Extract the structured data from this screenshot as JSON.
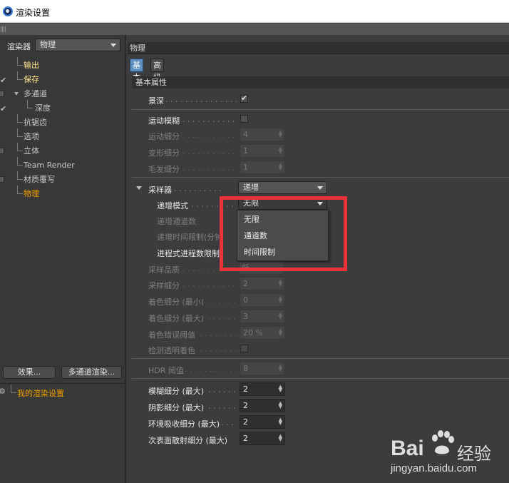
{
  "window": {
    "title": "渲染设置"
  },
  "left": {
    "renderer_label": "渲染器",
    "renderer_value": "物理",
    "tree": [
      {
        "label": "输出",
        "check": "none",
        "style": "hl"
      },
      {
        "label": "保存",
        "check": "tick",
        "style": "hl"
      },
      {
        "label": "多通道",
        "check": "box",
        "style": "normal",
        "expand": true
      },
      {
        "label": "深度",
        "check": "tick",
        "style": "normal",
        "sub": true
      },
      {
        "label": "抗锯齿",
        "check": "none",
        "style": "normal"
      },
      {
        "label": "选项",
        "check": "none",
        "style": "normal"
      },
      {
        "label": "立体",
        "check": "box",
        "style": "normal"
      },
      {
        "label": "Team Render",
        "check": "none",
        "style": "normal"
      },
      {
        "label": "材质覆写",
        "check": "box",
        "style": "normal"
      },
      {
        "label": "物理",
        "check": "none",
        "style": "or"
      }
    ],
    "effects_button": "效果...",
    "multipass_button": "多通道渲染...",
    "my_settings": "我的渲染设置"
  },
  "right": {
    "header": "物理",
    "tabs": [
      "基本",
      "高级"
    ],
    "section": "基本属性",
    "depth_of_field": {
      "label": "景深",
      "dots": " . . . . . . . . . . . . . . . . ",
      "checked": true
    },
    "motion_blur": {
      "label": "运动模糊",
      "dots": " . . . . . . . . . . . . ",
      "checked": false
    },
    "motion_sub": {
      "label": "运动细分",
      "dots": " . . . . . . . . . . . .",
      "value": "4"
    },
    "deform_sub": {
      "label": "变形细分",
      "dots": " . . . . . . . . . . . .",
      "value": "1"
    },
    "hair_sub": {
      "label": "毛发细分",
      "dots": " . . . . . . . . . . . .",
      "value": "1"
    },
    "sampler": {
      "label": "采样器",
      "dots": " . . . . . . . . . .",
      "value": "递增"
    },
    "inc_mode": {
      "label": "递增模式",
      "dots": " . . . . . . . . . .",
      "value": "无限"
    },
    "inc_passes": {
      "label": "递增通道数"
    },
    "inc_time": {
      "label": "递增时间限制(分钟"
    },
    "progressive": {
      "label": "进程式进程数限制"
    },
    "sampling_quality": {
      "label": "采样品质",
      "dots": " . . . . . . . . . . . .",
      "value": "低"
    },
    "sampling_sub": {
      "label": "采样细分",
      "dots": " . . . . . . . . . . . .",
      "value": "2"
    },
    "shade_min": {
      "label": "着色细分 (最小)",
      "dots": " . . . . . . .",
      "value": "0"
    },
    "shade_max": {
      "label": "着色细分 (最大)",
      "dots": " . . . . . . .",
      "value": "3"
    },
    "shade_err": {
      "label": "着色错误阈值",
      "dots": " . . . . . . . . .",
      "value": "20 %"
    },
    "detect_trans": {
      "label": "检测透明着色",
      "dots": " . . . . . . . . .",
      "checked": false
    },
    "hdr": {
      "label": "HDR 阈值",
      "dots": " . . . . . . . . . . . . .",
      "value": "8"
    },
    "blur_max": {
      "label": "模糊细分 (最大)",
      "dots": " . . . . . . .",
      "value": "2"
    },
    "shadow_max": {
      "label": "阴影细分 (最大)",
      "dots": " . . . . . . .",
      "value": "2"
    },
    "ao_max": {
      "label": "环境吸收细分 (最大)",
      "dots": " . . . .",
      "value": "2"
    },
    "sss_max": {
      "label": "次表面散射细分 (最大)",
      "dots": "",
      "value": "2"
    },
    "popup_options": [
      "无限",
      "通道数",
      "时间限制"
    ]
  },
  "watermark": {
    "brand": "Bai",
    "cn": "经验",
    "url": "jingyan.baidu.com"
  },
  "colors": {
    "highlight": "#e8333a",
    "active_tab": "#5e8fc0",
    "selected_item": "#f0a000"
  }
}
